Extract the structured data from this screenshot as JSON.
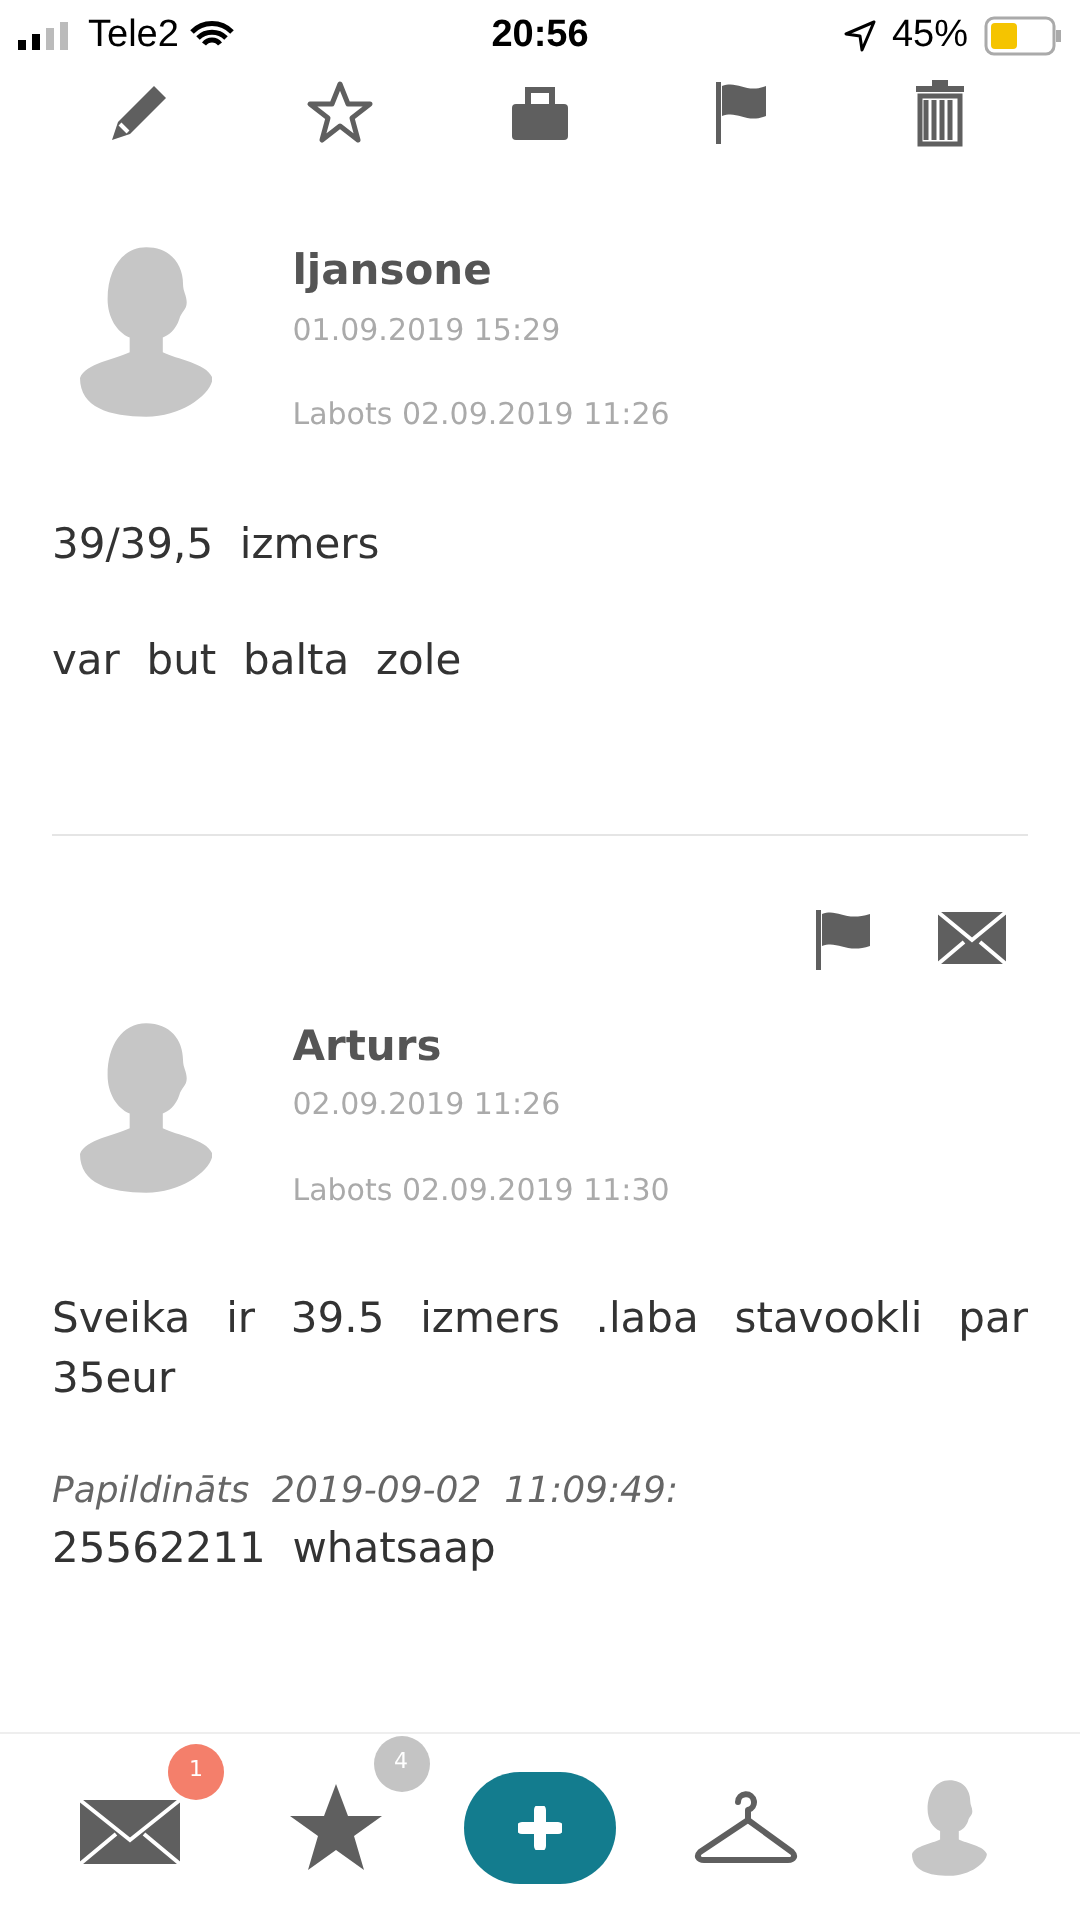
{
  "status_bar": {
    "carrier": "Tele2",
    "time": "20:56",
    "battery": "45%"
  },
  "toolbar": [
    {
      "kind": "edit"
    },
    {
      "kind": "favorite"
    },
    {
      "kind": "bag"
    },
    {
      "kind": "flag"
    },
    {
      "kind": "delete"
    }
  ],
  "comments": [
    {
      "author": "ljansone",
      "date": "01.09.2019 15:29",
      "edited": "Labots 02.09.2019 11:26",
      "paragraphs": [
        "39/39,5  izmers",
        "var  but  balta  zole"
      ],
      "actions": false
    },
    {
      "author": "Arturs",
      "date": "02.09.2019 11:26",
      "edited": "Labots 02.09.2019 11:30",
      "paragraphs": [
        "Sveika ir 39.5 izmers .laba stavookli par 35eur"
      ],
      "addendum_label": "Papildināts  2019-09-02  11:09:49:",
      "addendum_text": "25562211  whatsaap",
      "actions": true
    }
  ],
  "bottom_nav": [
    {
      "kind": "mail",
      "badge": "1",
      "color": "#f47f6b"
    },
    {
      "kind": "star",
      "badge": "4",
      "color": "#c4c4c4"
    },
    {
      "kind": "add"
    },
    {
      "kind": "hanger"
    },
    {
      "kind": "profile"
    }
  ]
}
